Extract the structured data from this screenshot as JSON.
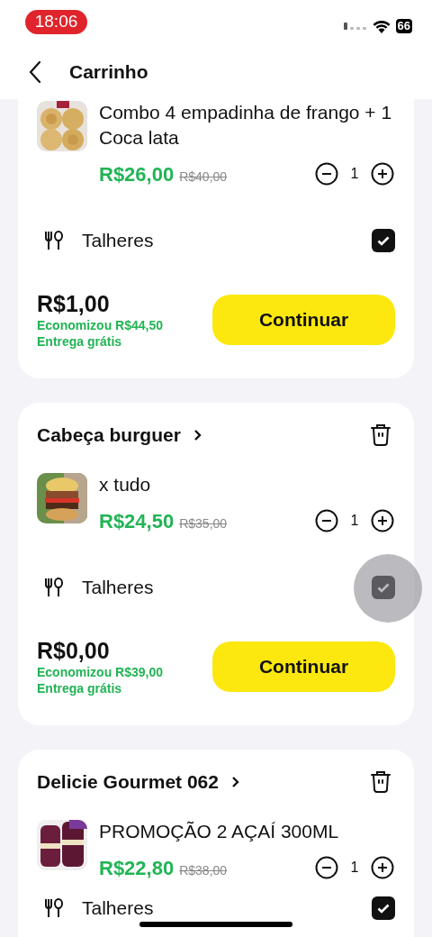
{
  "status_bar": {
    "time": "18:06",
    "battery": "66"
  },
  "header": {
    "title": "Carrinho"
  },
  "carts": [
    {
      "items": [
        {
          "name": "Combo 4 empadinha de frango + 1 Coca lata",
          "price": "R$26,00",
          "original_price": "R$40,00",
          "quantity": "1"
        }
      ],
      "cutlery": {
        "label": "Talheres",
        "checked": true,
        "touched": false
      },
      "total": "R$1,00",
      "savings": "Economizou R$44,50",
      "delivery": "Entrega grátis",
      "button": "Continuar"
    },
    {
      "store": "Cabeça burguer",
      "items": [
        {
          "name": "x tudo",
          "price": "R$24,50",
          "original_price": "R$35,00",
          "quantity": "1"
        }
      ],
      "cutlery": {
        "label": "Talheres",
        "checked": true,
        "touched": true
      },
      "total": "R$0,00",
      "savings": "Economizou R$39,00",
      "delivery": "Entrega grátis",
      "button": "Continuar"
    },
    {
      "store": "Delicie Gourmet 062",
      "items": [
        {
          "name": "PROMOÇÃO 2 AÇAÍ 300ML",
          "price": "R$22,80",
          "original_price": "R$38,00",
          "quantity": "1"
        }
      ],
      "cutlery": {
        "label": "Talheres",
        "checked": true,
        "touched": false
      }
    }
  ]
}
